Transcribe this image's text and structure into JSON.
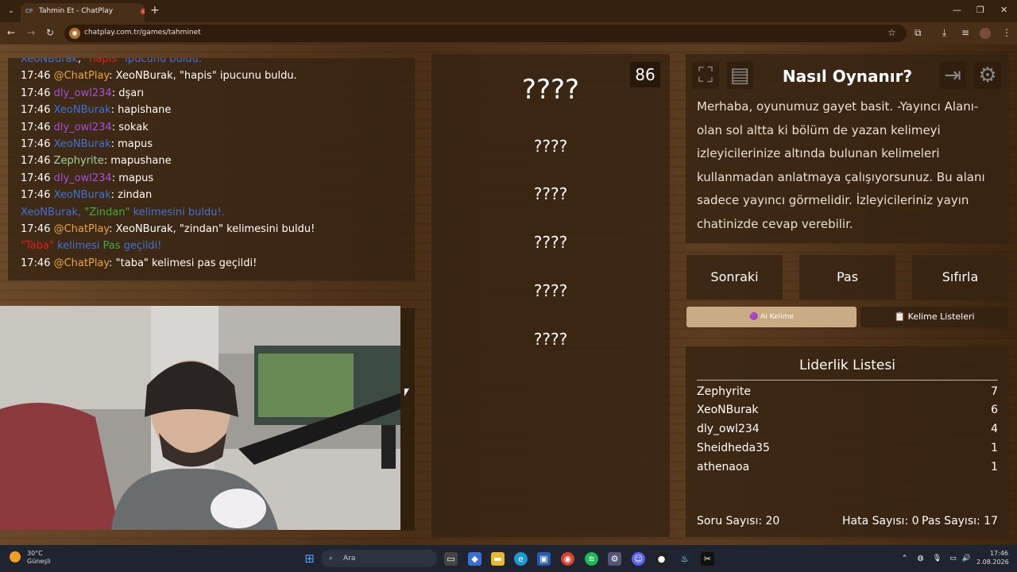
{
  "browser": {
    "tab_title": "Tahmin Et - ChatPlay",
    "tab_favicon": "CP",
    "url": "chatplay.com.tr/games/tahminet"
  },
  "chat": {
    "lines": [
      [
        {
          "c": "u-xeo",
          "t": "XeoNBurak"
        },
        {
          "c": "t",
          "t": ", "
        },
        {
          "c": "sys-red",
          "t": "\"hapis\""
        },
        {
          "c": "sys-blue",
          "t": " ipucunu buldu."
        }
      ],
      [
        {
          "c": "t",
          "t": "17:46 "
        },
        {
          "c": "u-chatplay",
          "t": "@ChatPlay"
        },
        {
          "c": "t",
          "t": ": XeoNBurak, \"hapis\" ipucunu buldu."
        }
      ],
      [
        {
          "c": "t",
          "t": "17:46 "
        },
        {
          "c": "u-dly",
          "t": "dly_owl234"
        },
        {
          "c": "t",
          "t": ": dşarı"
        }
      ],
      [
        {
          "c": "t",
          "t": "17:46 "
        },
        {
          "c": "u-xeo",
          "t": "XeoNBurak"
        },
        {
          "c": "t",
          "t": ": hapishane"
        }
      ],
      [
        {
          "c": "t",
          "t": "17:46 "
        },
        {
          "c": "u-dly",
          "t": "dly_owl234"
        },
        {
          "c": "t",
          "t": ": sokak"
        }
      ],
      [
        {
          "c": "t",
          "t": "17:46 "
        },
        {
          "c": "u-xeo",
          "t": "XeoNBurak"
        },
        {
          "c": "t",
          "t": ": mapus"
        }
      ],
      [
        {
          "c": "t",
          "t": "17:46 "
        },
        {
          "c": "u-zeph",
          "t": "Zephyrite"
        },
        {
          "c": "t",
          "t": ": mapushane"
        }
      ],
      [
        {
          "c": "t",
          "t": "17:46 "
        },
        {
          "c": "u-dly",
          "t": "dly_owl234"
        },
        {
          "c": "t",
          "t": ": mapus"
        }
      ],
      [
        {
          "c": "t",
          "t": "17:46 "
        },
        {
          "c": "u-xeo",
          "t": "XeoNBurak"
        },
        {
          "c": "t",
          "t": ": zindan"
        }
      ],
      [
        {
          "c": "u-xeo",
          "t": "XeoNBurak"
        },
        {
          "c": "sys-blue",
          "t": ", "
        },
        {
          "c": "sys-green",
          "t": "\"Zindan\""
        },
        {
          "c": "sys-blue",
          "t": " kelimesini buldu!."
        }
      ],
      [
        {
          "c": "t",
          "t": "17:46 "
        },
        {
          "c": "u-chatplay",
          "t": "@ChatPlay"
        },
        {
          "c": "t",
          "t": ": XeoNBurak, \"zindan\" kelimesini buldu!"
        }
      ],
      [
        {
          "c": "sys-red",
          "t": "\"Taba\""
        },
        {
          "c": "sys-blue",
          "t": " kelimesi "
        },
        {
          "c": "sys-green",
          "t": "Pas"
        },
        {
          "c": "sys-blue",
          "t": " geçildi!"
        }
      ],
      [
        {
          "c": "t",
          "t": "17:46 "
        },
        {
          "c": "u-chatplay",
          "t": "@ChatPlay"
        },
        {
          "c": "t",
          "t": ": \"taba\" kelimesi pas geçildi!"
        }
      ]
    ]
  },
  "words": {
    "timer": "86",
    "main": "????",
    "forbidden": [
      "????",
      "????",
      "????",
      "????",
      "????"
    ]
  },
  "howto": {
    "title": "Nasıl Oynanır?",
    "text": "Merhaba, oyunumuz gayet basit. -Yayıncı Alanı- olan sol altta ki bölüm de yazan kelimeyi izleyicilerinize altında bulunan kelimeleri kullanmadan anlatmaya çalışıyorsunuz. Bu alanı sadece yayıncı görmelidir. İzleyicileriniz yayın chatinizde cevap verebilir."
  },
  "buttons": {
    "next": "Sonraki",
    "pass": "Pas",
    "reset": "Sıfırla",
    "ai": "🟣 AI Kelime",
    "lists": "📋 Kelime Listeleri"
  },
  "leaderboard": {
    "title": "Liderlik Listesi",
    "rows": [
      {
        "name": "Zephyrite",
        "score": "7"
      },
      {
        "name": "XeoNBurak",
        "score": "6"
      },
      {
        "name": "dly_owl234",
        "score": "4"
      },
      {
        "name": "Sheidheda35",
        "score": "1"
      },
      {
        "name": "athenaoa",
        "score": "1"
      }
    ],
    "questions": "Soru Sayısı: 20",
    "errors": "Hata Sayısı: 0",
    "passes": "Pas Sayısı: 17"
  },
  "taskbar": {
    "temp": "30°C",
    "condition": "Güneşli",
    "search_placeholder": "Ara",
    "time": "17:46",
    "date": "2.08.2026"
  }
}
